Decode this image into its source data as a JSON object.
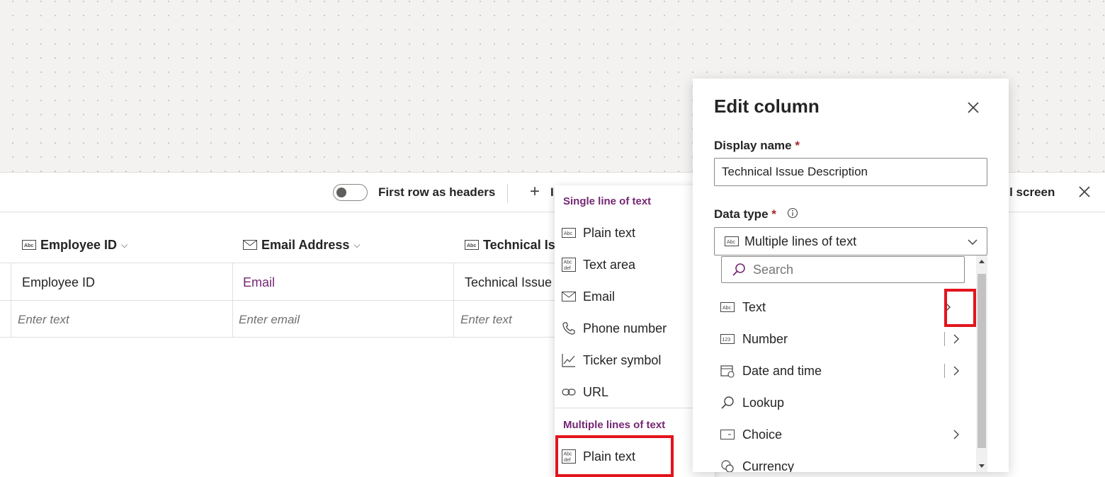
{
  "toolbar": {
    "first_row_headers": "First row as headers",
    "add_trunc": "I",
    "fullscreen_trunc": "ull screen"
  },
  "table": {
    "headers": [
      "Employee ID",
      "Email Address",
      "Technical Issu"
    ],
    "row1": [
      "Employee ID",
      "Email",
      "Technical Issue"
    ],
    "row2": [
      "Enter text",
      "Enter email",
      "Enter text"
    ]
  },
  "flyout": {
    "single_header": "Single line of text",
    "single_items": [
      "Plain text",
      "Text area",
      "Email",
      "Phone number",
      "Ticker symbol",
      "URL"
    ],
    "multi_header": "Multiple lines of text",
    "multi_items": [
      "Plain text"
    ]
  },
  "panel": {
    "title": "Edit column",
    "display_name_label": "Display name",
    "display_name_value": "Technical Issue Description",
    "data_type_label": "Data type",
    "required_mark": "*",
    "data_type_value": "Multiple lines of text",
    "search_placeholder": "Search",
    "types": [
      "Text",
      "Number",
      "Date and time",
      "Lookup",
      "Choice",
      "Currency"
    ]
  },
  "colors": {
    "accent": "#742774",
    "highlight": "#e3141c"
  }
}
